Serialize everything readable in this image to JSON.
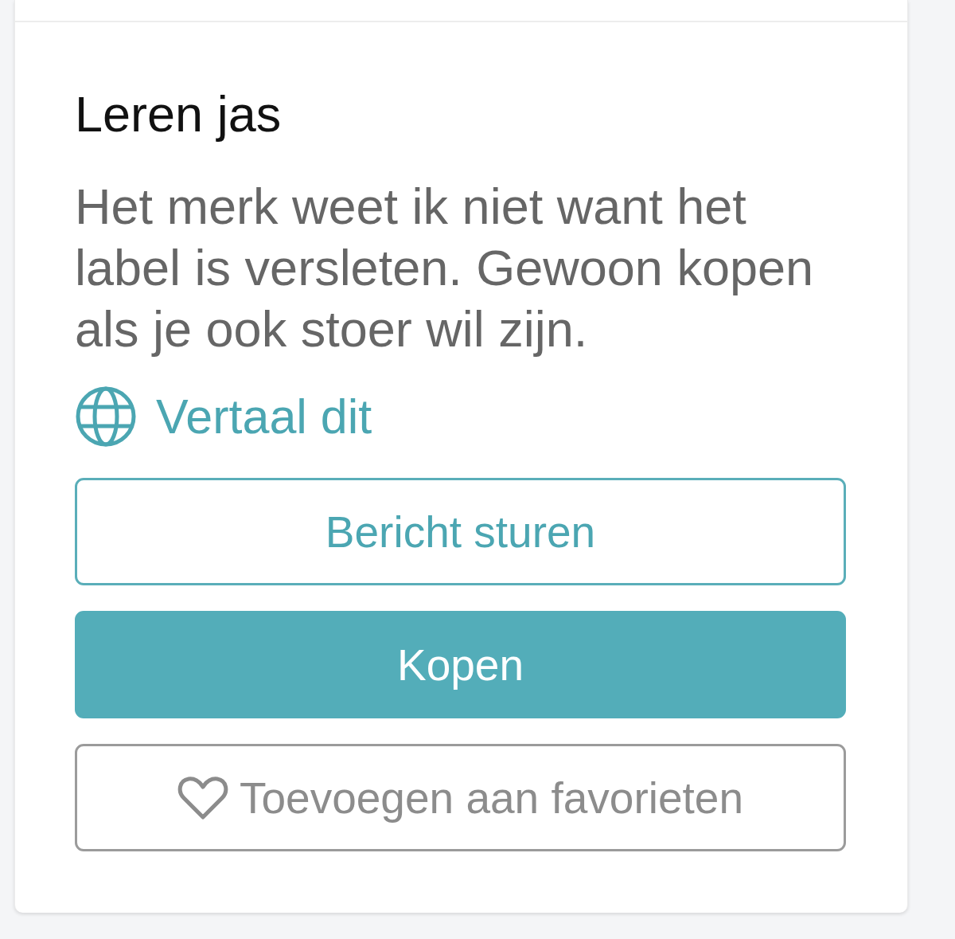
{
  "listing": {
    "title": "Leren jas",
    "description": "Het merk weet ik niet want het label is versleten. Gewoon kopen als je ook stoer wil zijn.",
    "translate_link": "Vertaal dit"
  },
  "buttons": [
    {
      "label": "Bericht sturen",
      "kind": "outline"
    },
    {
      "label": "Kopen",
      "kind": "primary"
    },
    {
      "label": "Toevoegen aan favorieten",
      "kind": "favorite"
    }
  ]
}
